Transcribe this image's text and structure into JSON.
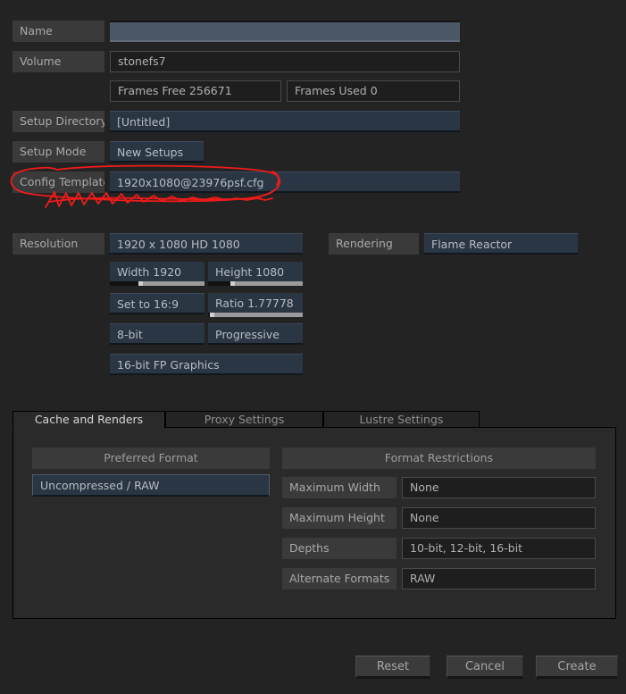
{
  "form": {
    "rows": [
      {
        "label": "Name",
        "value": "",
        "kind": "blue-active"
      },
      {
        "label": "Volume",
        "value": "stonefs7",
        "kind": "field"
      },
      {
        "label": "",
        "value": "Frames Free 256671",
        "kind": "field-split",
        "value2": "Frames Used 0"
      },
      {
        "label": "Setup Directory",
        "value": "[Untitled]",
        "kind": "blue"
      },
      {
        "label": "Setup Mode",
        "value": "New Setups",
        "kind": "blue-short"
      },
      {
        "label": "Config Template",
        "value": "1920x1080@23976psf.cfg",
        "kind": "blue"
      }
    ]
  },
  "resolution": {
    "label": "Resolution",
    "preset": "1920 x 1080 HD 1080",
    "width": "Width 1920",
    "height": "Height 1080",
    "set_ratio": "Set to 16:9",
    "ratio": "Ratio 1.77778",
    "bit_depth": "8-bit",
    "scan_mode": "Progressive",
    "graphics": "16-bit FP Graphics"
  },
  "rendering": {
    "label": "Rendering",
    "engine": "Flame Reactor"
  },
  "tabs": [
    {
      "label": "Cache and Renders",
      "active": true
    },
    {
      "label": "Proxy Settings",
      "active": false
    },
    {
      "label": "Lustre Settings",
      "active": false
    }
  ],
  "cache_panel": {
    "preferred_format": {
      "header": "Preferred Format",
      "items": [
        "Uncompressed / RAW"
      ],
      "selected": "Uncompressed / RAW"
    },
    "format_restrictions": {
      "header": "Format Restrictions",
      "rows": [
        {
          "label": "Maximum Width",
          "value": "None"
        },
        {
          "label": "Maximum Height",
          "value": "None"
        },
        {
          "label": "Depths",
          "value": "10-bit, 12-bit, 16-bit"
        },
        {
          "label": "Alternate Formats",
          "value": "RAW"
        }
      ]
    }
  },
  "actions": {
    "reset": "Reset",
    "cancel": "Cancel",
    "create": "Create"
  },
  "annotation": {
    "color": "#ee1b1b",
    "target": "Config Template"
  },
  "colors": {
    "background": "#232323",
    "label_bg": "#3a3a3a",
    "field_bg": "#1e1e1e",
    "blue_field": "#2b3644",
    "active_field": "#4c5768",
    "annotation_red": "#ee1b1b"
  }
}
